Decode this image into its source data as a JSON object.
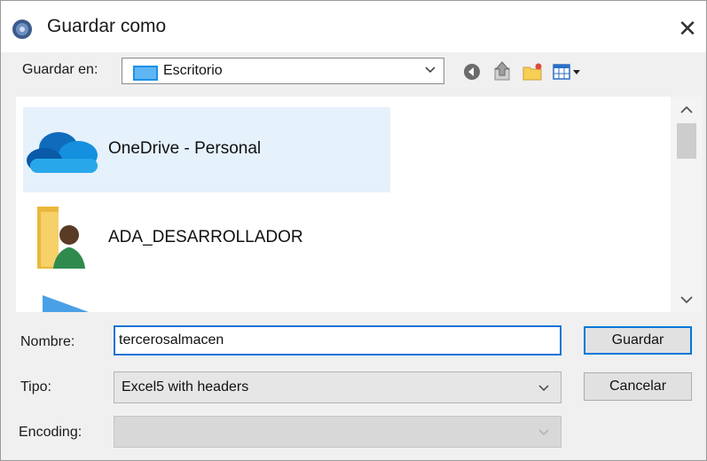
{
  "window": {
    "title": "Guardar como",
    "close_glyph": "✕"
  },
  "save_in": {
    "label": "Guardar en:",
    "value": "Escritorio"
  },
  "files": [
    {
      "name": "OneDrive - Personal",
      "icon": "onedrive-cloud-icon",
      "selected": true
    },
    {
      "name": "ADA_DESARROLLADOR",
      "icon": "user-folder-icon",
      "selected": false
    },
    {
      "name": "",
      "icon": "partial-item-icon",
      "selected": false
    }
  ],
  "form": {
    "name_label": "Nombre:",
    "name_value": "tercerosalmacen",
    "type_label": "Tipo:",
    "type_value": "Excel5 with headers",
    "encoding_label": "Encoding:",
    "encoding_value": ""
  },
  "buttons": {
    "save": "Guardar",
    "cancel": "Cancelar"
  },
  "colors": {
    "accent": "#0078d7",
    "selection": "#e5f1fb",
    "onedrive": "#0a74d0"
  }
}
